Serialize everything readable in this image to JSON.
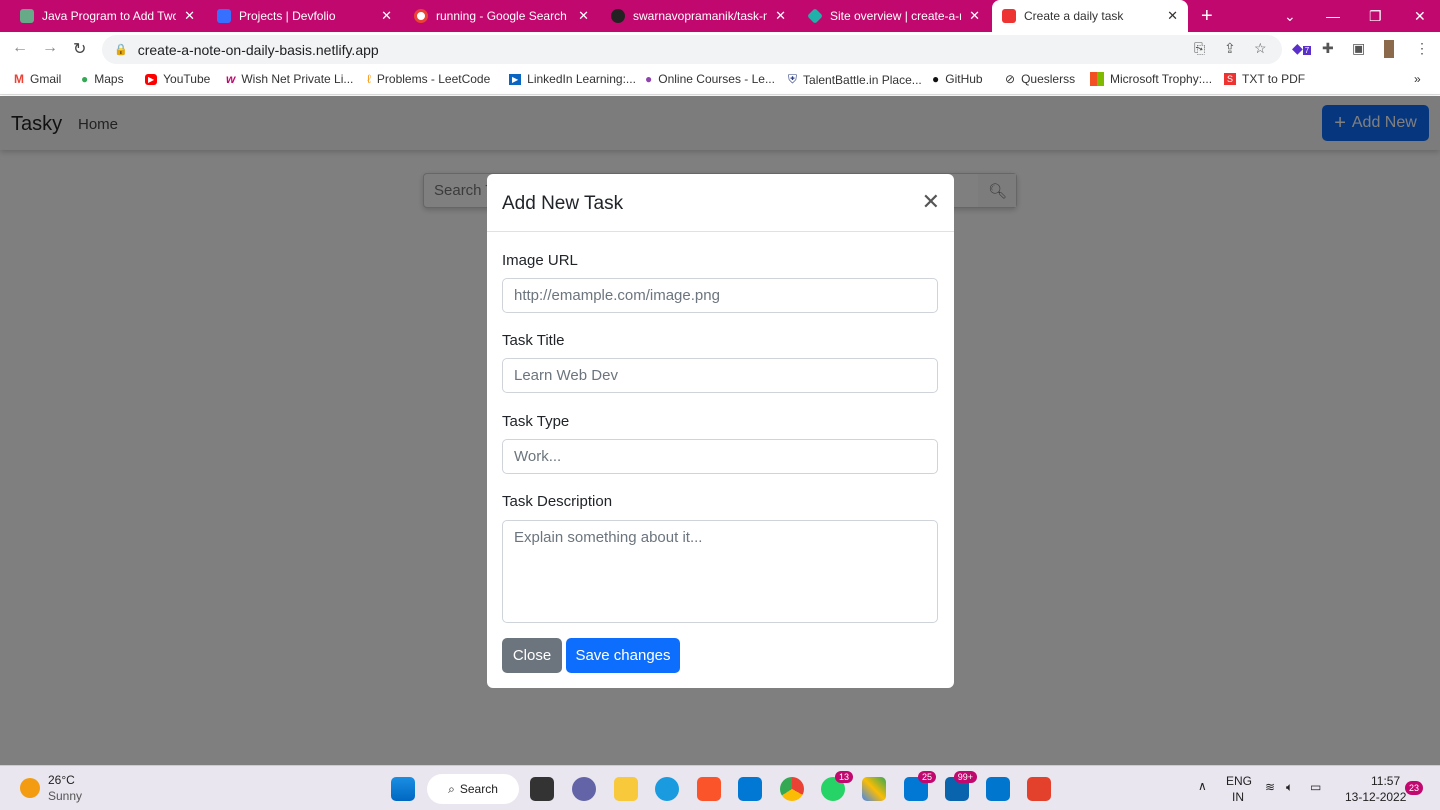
{
  "browser": {
    "tabs": [
      {
        "title": "Java Program to Add Two n",
        "favicon": "#6a8"
      },
      {
        "title": "Projects | Devfolio",
        "favicon": "#3770ff"
      },
      {
        "title": "running - Google Search",
        "favicon": "#ea4335"
      },
      {
        "title": "swarnavopramanik/task-ma",
        "favicon": "#222"
      },
      {
        "title": "Site overview | create-a-not",
        "favicon": "#20b2aa"
      },
      {
        "title": "Create a daily task",
        "favicon": "#e33",
        "active": true
      }
    ],
    "url": "create-a-note-on-daily-basis.netlify.app",
    "extension_badge": "7",
    "bookmarks": [
      "Gmail",
      "Maps",
      "YouTube",
      "Wish Net Private Li...",
      "Problems - LeetCode",
      "LinkedIn Learning:...",
      "Online Courses - Le...",
      "TalentBattle.in Place...",
      "GitHub",
      "Queslerss",
      "Microsoft Trophy:...",
      "TXT to PDF"
    ],
    "bookmarks_more": "»"
  },
  "app": {
    "brand": "Tasky",
    "home": "Home",
    "add_new": "Add New",
    "search_placeholder": "Search Task"
  },
  "modal": {
    "title": "Add New Task",
    "fields": [
      {
        "label": "Image URL",
        "placeholder": "http://emample.com/image.png"
      },
      {
        "label": "Task Title",
        "placeholder": "Learn Web Dev"
      },
      {
        "label": "Task Type",
        "placeholder": "Work..."
      },
      {
        "label": "Task Description",
        "placeholder": "Explain something about it..."
      }
    ],
    "close": "Close",
    "save": "Save changes"
  },
  "colors": {
    "tabbar": "#c1086e",
    "primary": "#0d6efd",
    "secondary": "#6c757d"
  },
  "taskbar": {
    "weather_temp": "26°C",
    "weather_desc": "Sunny",
    "search": "Search",
    "badges": {
      "whatsapp": "13",
      "app25": "25",
      "mail": "99+"
    },
    "lang": "ENG",
    "region": "IN",
    "time": "11:57",
    "date": "13-12-2022",
    "notifications": "23"
  }
}
